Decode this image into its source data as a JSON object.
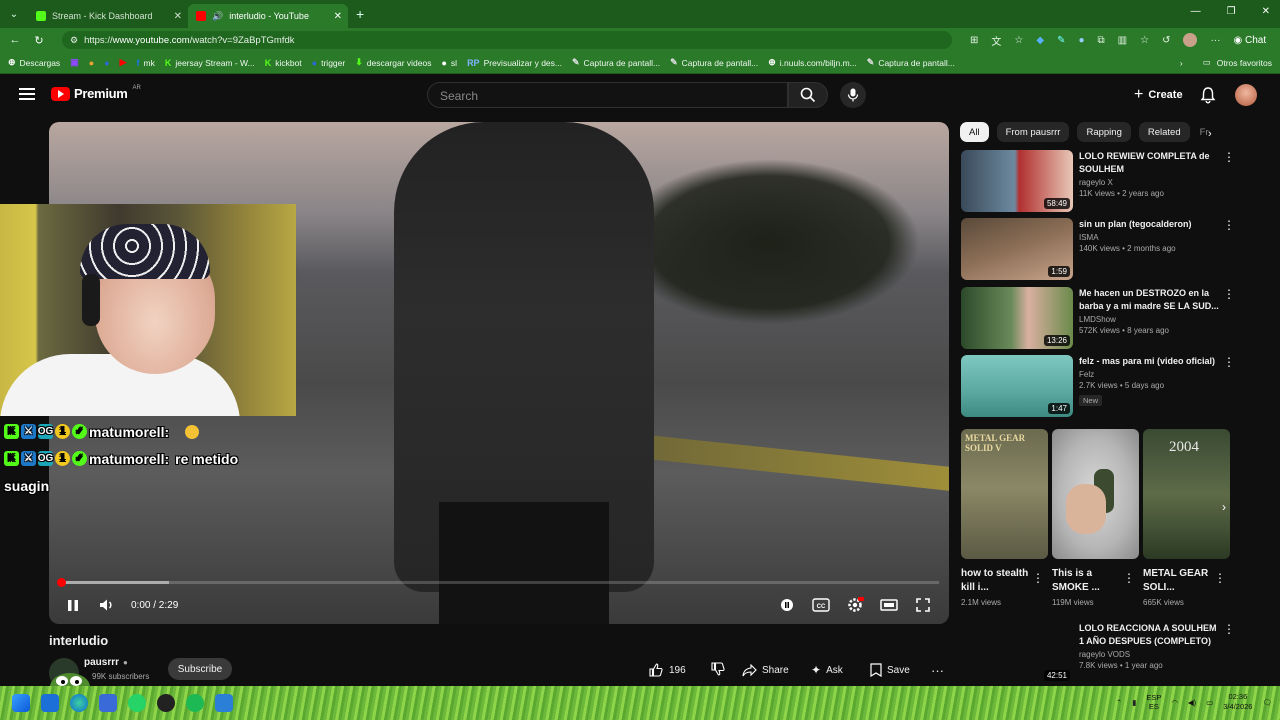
{
  "browser": {
    "tabs": [
      {
        "title": "Stream - Kick Dashboard",
        "active": false
      },
      {
        "title": "interludio - YouTube",
        "active": true
      }
    ],
    "url_prefix": "https://",
    "url_host": "www.youtube.com",
    "url_path": "/watch?v=9ZaBpTGmfdk",
    "bookmarks": [
      {
        "label": "Descargas",
        "icon": "globe-icon",
        "color": "#ffffff"
      },
      {
        "label": "",
        "icon": "twitch-icon",
        "color": "#9146ff"
      },
      {
        "label": "",
        "icon": "bookmark-icon",
        "color": "#f0a030"
      },
      {
        "label": "",
        "icon": "bookmark-icon",
        "color": "#2a6ad8"
      },
      {
        "label": "",
        "icon": "youtube-icon",
        "color": "#ff0000"
      },
      {
        "label": "mk",
        "icon": "facebook-icon",
        "color": "#1877f2"
      },
      {
        "label": "jeersay Stream - W...",
        "icon": "kick-icon",
        "color": "#53fc18"
      },
      {
        "label": "kickbot",
        "icon": "kick-icon",
        "color": "#53fc18"
      },
      {
        "label": "trigger",
        "icon": "bookmark-icon",
        "color": "#2a6ad8"
      },
      {
        "label": "descargar videos",
        "icon": "download-icon",
        "color": "#53fc18"
      },
      {
        "label": "sl",
        "icon": "bookmark-icon",
        "color": "#ffffff"
      },
      {
        "label": "Previsualizar y des...",
        "icon": "rp-icon",
        "color": "#7fb3ff"
      },
      {
        "label": "Captura de pantall...",
        "icon": "pen-icon",
        "color": "#dddddd"
      },
      {
        "label": "Captura de pantall...",
        "icon": "pen-icon",
        "color": "#dddddd"
      },
      {
        "label": "i.nuuls.com/biljn.m...",
        "icon": "globe-icon",
        "color": "#ffffff"
      },
      {
        "label": "Captura de pantall...",
        "icon": "pen-icon",
        "color": "#dddddd"
      }
    ],
    "other_bookmarks": "Otros favoritos",
    "copilot_label": "Chat"
  },
  "youtube": {
    "logo_text": "Premium",
    "logo_country": "AR",
    "search_placeholder": "Search",
    "create_label": "Create"
  },
  "player": {
    "time_current": "0:00",
    "time_total": "2:29",
    "time_display": "0:00 / 2:29"
  },
  "chat": {
    "lines": [
      {
        "user": "matumorell:",
        "message": ""
      },
      {
        "user": "matumorell:",
        "message": "re metido"
      }
    ],
    "extra": "suagin"
  },
  "video": {
    "title": "interludio",
    "channel": "pausrrr",
    "subscribers": "99K subscribers",
    "subscribe_label": "Subscribe",
    "likes": "196",
    "share_label": "Share",
    "ask_label": "Ask",
    "save_label": "Save"
  },
  "chips": [
    "All",
    "From pausrrr",
    "Rapping",
    "Related",
    "Fr"
  ],
  "recommendations": [
    {
      "title": "LOLO REWIEW COMPLETA de SOULHEM",
      "channel": "rageylo X",
      "views": "11K views • 2 years ago",
      "duration": "58:49",
      "is_new": false
    },
    {
      "title": "sin un plan (tegocalderon)",
      "channel": "ISMA",
      "views": "140K views • 2 months ago",
      "duration": "1:59",
      "is_new": false
    },
    {
      "title": "Me hacen un DESTROZO en la barba y a mi madre SE LA SUD...",
      "channel": "LMDShow",
      "views": "572K views • 8 years ago",
      "duration": "13:26",
      "is_new": false
    },
    {
      "title": "felz - mas para mi (video oficial)",
      "channel": "Felz",
      "views": "2.7K views • 5 days ago",
      "duration": "1:47",
      "is_new": true,
      "new_label": "New"
    }
  ],
  "shorts": [
    {
      "title": "how to stealth kill i...",
      "views": "2.1M views",
      "overlay": "METAL GEAR SOLID V"
    },
    {
      "title": "This is a SMOKE ...",
      "views": "119M views",
      "overlay": ""
    },
    {
      "title": "METAL GEAR SOLI...",
      "views": "665K views",
      "overlay": "2004"
    }
  ],
  "bottom_rec": {
    "title": "LOLO REACCIONA A SOULHEM 1 AÑO DESPUES (COMPLETO)",
    "channel": "rageylo VODS",
    "views": "7.8K views • 1 year ago",
    "duration": "42:51"
  },
  "taskbar": {
    "lang_top": "ESP",
    "lang_bottom": "ES",
    "time": "02:36",
    "date": "3/4/2026"
  }
}
